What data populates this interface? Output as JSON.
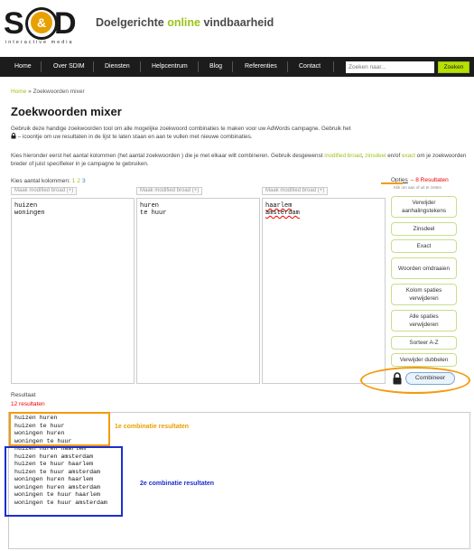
{
  "header": {
    "logo_left": "S",
    "logo_amp": "&",
    "logo_right": "D",
    "logo_sub": "interactive media",
    "tagline_part1": "Doelgerichte ",
    "tagline_highlight": "online",
    "tagline_part2": " vindbaarheid"
  },
  "nav": {
    "items": [
      "Home",
      "Over SDIM",
      "Diensten",
      "Helpcentrum",
      "Blog",
      "Referenties",
      "Contact"
    ],
    "search_placeholder": "Zoeken naar...",
    "search_button": "Zoeken"
  },
  "breadcrumb": {
    "home": "Home",
    "separator": " » ",
    "current": "Zoekwoorden mixer"
  },
  "page": {
    "title": "Zoekwoorden mixer",
    "intro1": "Gebruik deze handige zoekwoorden tool om alle mogelijke zoekwoord combinaties te maken voor uw AdWords campagne. Gebruik het",
    "intro1b": " – icoontje om uw resultaten in de lijst te laten staan en aan te vullen met nieuwe combinaties.",
    "intro2_a": "Kies hieronder eerst het aantal kolommen (het aantal zoekwoorden ) die je met elkaar wilt combineren. Gebruik desgewenst ",
    "intro2_modified": "modified broad",
    "intro2_b": ", ",
    "intro2_zinsdeel": "zinsdeel",
    "intro2_c": " en/of ",
    "intro2_exact": "exact",
    "intro2_d": " om je zoekwoorden breder of juist specifieker in je campagne te gebruiken."
  },
  "columns": {
    "label": "Kies aantal kolommen:",
    "counts": [
      "1",
      "2",
      "3"
    ],
    "modified_label": "Maak modified broad (+)",
    "col1": [
      "huizen",
      "woningen"
    ],
    "col2": [
      "huren",
      "te huur"
    ],
    "col3": [
      "haarlem",
      "amsterdam"
    ]
  },
  "options": {
    "title": "Opties",
    "results": "– 8 Resultaten",
    "hint": "Klik om aan of uit te zetten",
    "buttons": [
      "Verwijder aanhalingstekens",
      "Zinsdeel",
      "Exact",
      "Woorden omdraaien",
      "Kolom spaties verwijderen",
      "Alle spaties verwijderen",
      "Sorteer A-Z",
      "Verwijder dubbelen"
    ],
    "combine": "Combineer"
  },
  "result": {
    "title": "Resultaat",
    "count": "12 resultaten",
    "lines": [
      "huizen huren",
      "huizen te huur",
      "woningen huren",
      "woningen te huur",
      "huizen huren haarlem",
      "huizen huren amsterdam",
      "huizen te huur haarlem",
      "huizen te huur amsterdam",
      "woningen huren haarlem",
      "woningen huren amsterdam",
      "woningen te huur haarlem",
      "woningen te huur amsterdam"
    ]
  },
  "annotations": {
    "first": "1e combinatie resultaten",
    "second": "2e combinatie resultaten"
  },
  "colors": {
    "accent_green": "#9cc21a",
    "nav_bg": "#1c1c1c",
    "annotation_orange": "#f59a0a",
    "annotation_blue": "#1a2fd0",
    "result_red": "#e00000"
  }
}
